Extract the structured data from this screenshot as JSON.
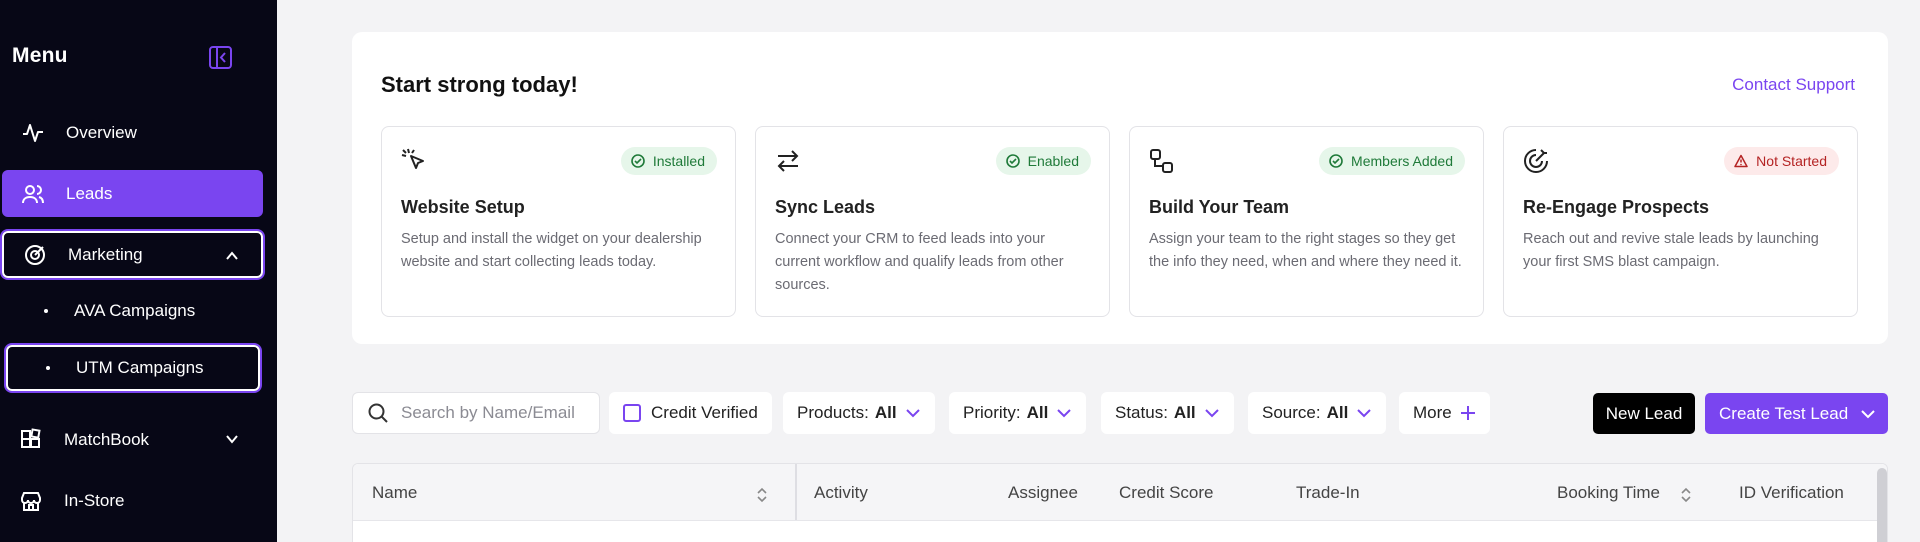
{
  "sidebar": {
    "title": "Menu",
    "items": [
      {
        "label": "Overview",
        "icon": "activity-icon"
      },
      {
        "label": "Leads",
        "icon": "users-icon"
      },
      {
        "label": "Marketing",
        "icon": "target-icon"
      },
      {
        "label": "MatchBook",
        "icon": "grid-icon"
      },
      {
        "label": "In-Store",
        "icon": "store-icon"
      }
    ],
    "subitems": [
      {
        "label": "AVA Campaigns"
      },
      {
        "label": "UTM Campaigns"
      }
    ]
  },
  "onboarding": {
    "title": "Start strong today!",
    "contact_label": "Contact Support",
    "steps": [
      {
        "title": "Website Setup",
        "badge": "Installed",
        "desc": "Setup and install the widget on your dealership website and start collecting leads today.",
        "icon": "cursor-click-icon"
      },
      {
        "title": "Sync Leads",
        "badge": "Enabled",
        "desc": "Connect your CRM to feed leads into your current workflow and qualify leads from other sources.",
        "icon": "arrows-swap-icon"
      },
      {
        "title": "Build Your Team",
        "badge": "Members Added",
        "desc": "Assign your team to the right stages so they get the info they need, when and where they need it.",
        "icon": "nodes-icon"
      },
      {
        "title": "Re-Engage Prospects",
        "badge": "Not Started",
        "desc": "Reach out and revive stale leads by launching your first SMS blast campaign.",
        "icon": "target-icon"
      }
    ]
  },
  "toolbar": {
    "search_placeholder": "Search by Name/Email",
    "credit_verified": "Credit Verified",
    "filters": [
      {
        "label": "Products:",
        "value": "All"
      },
      {
        "label": "Priority:",
        "value": "All"
      },
      {
        "label": "Status:",
        "value": "All"
      },
      {
        "label": "Source:",
        "value": "All"
      }
    ],
    "more_label": "More",
    "new_lead_label": "New Lead",
    "create_test_lead_label": "Create Test Lead"
  },
  "table": {
    "columns": [
      "Name",
      "Activity",
      "Assignee",
      "Credit Score",
      "Trade-In",
      "Booking Time",
      "ID Verification"
    ]
  },
  "colors": {
    "accent": "#7a45f0",
    "sidebar_bg": "#070716",
    "success_bg": "#e6f6ea",
    "success_text": "#1f7a39",
    "danger_bg": "#fdeaea",
    "danger_text": "#b42323"
  }
}
